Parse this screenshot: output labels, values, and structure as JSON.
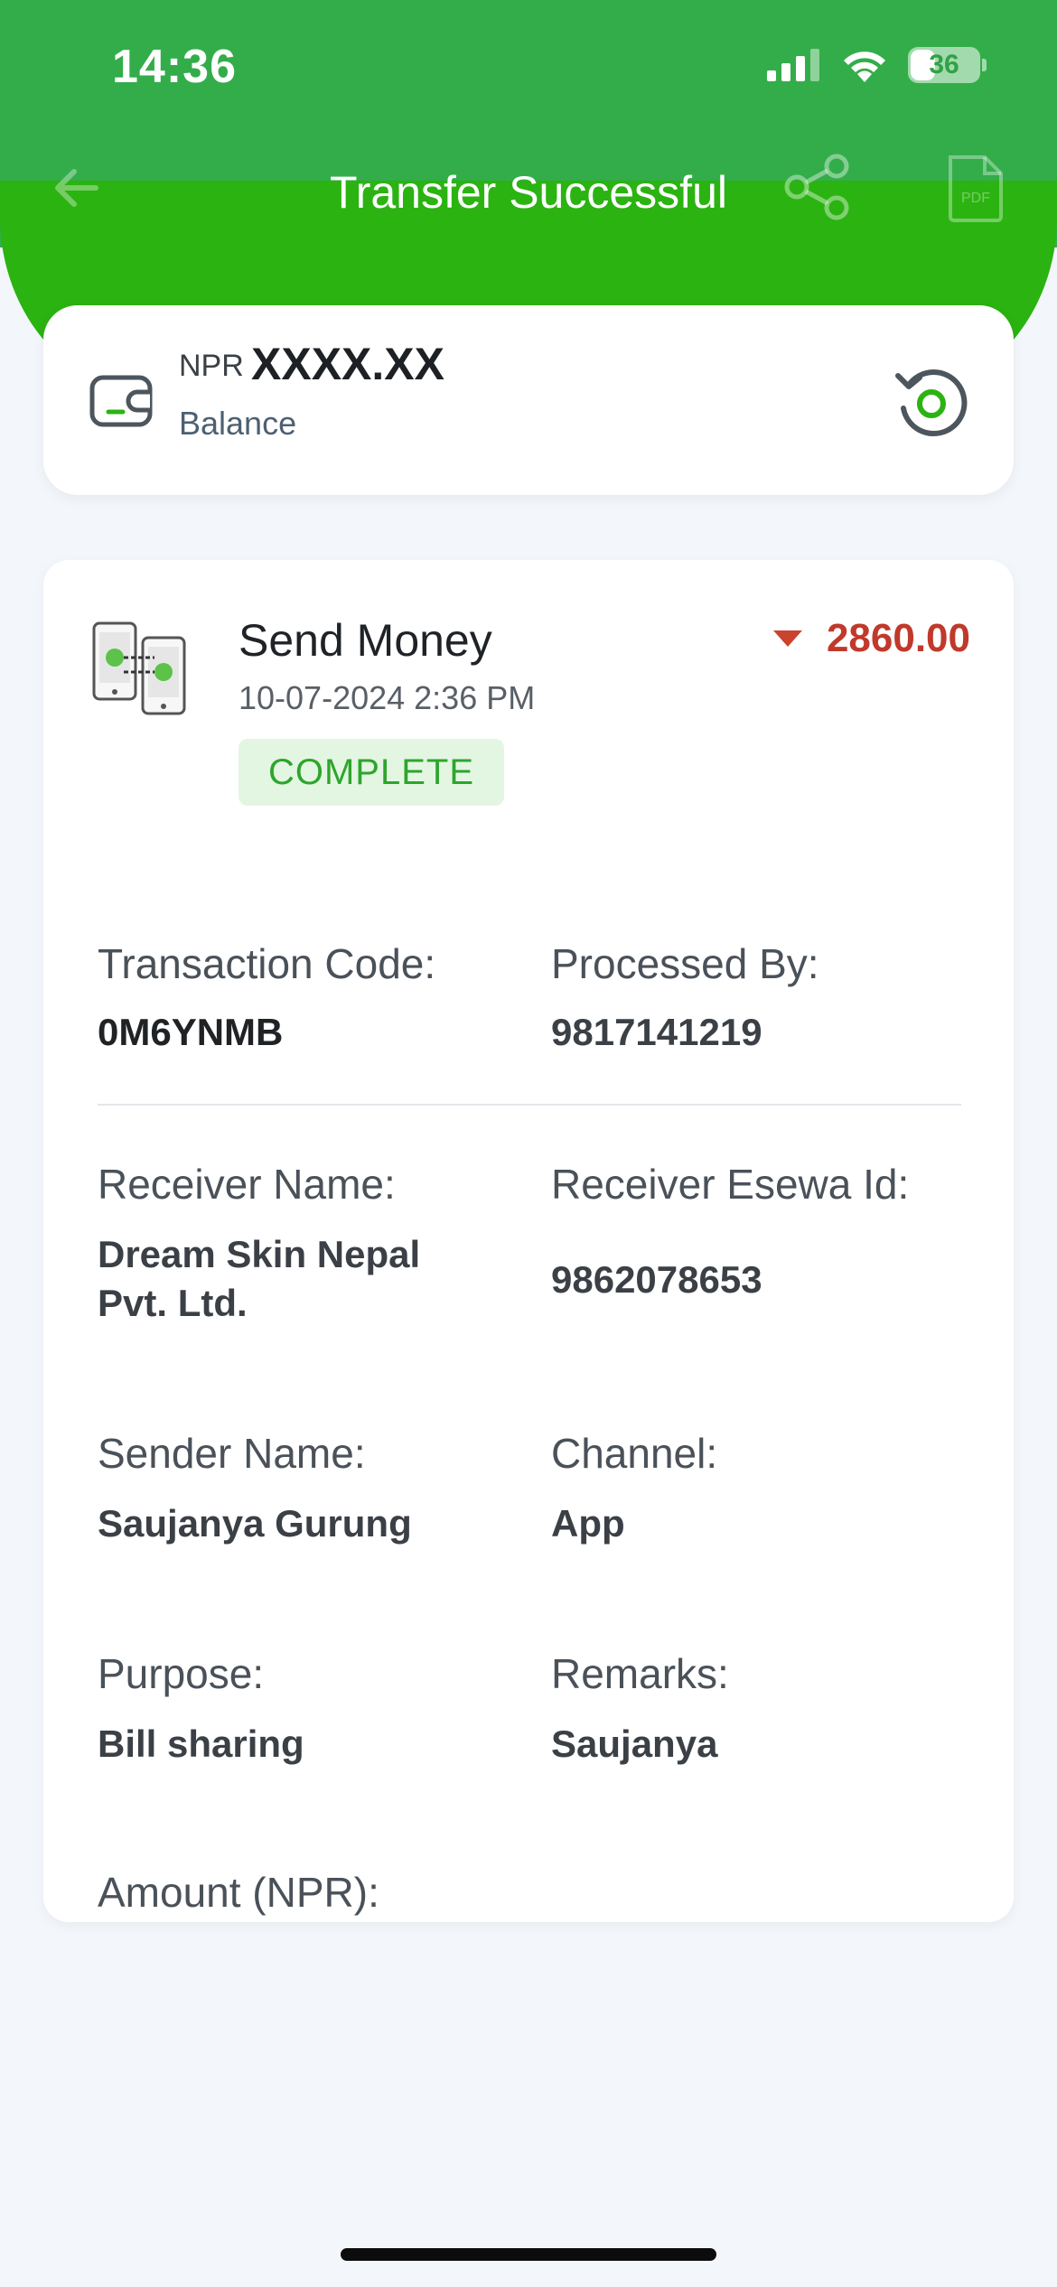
{
  "status_bar": {
    "time": "14:36",
    "battery": "36",
    "battery_level": 0.36,
    "icons": [
      "signal-icon",
      "wifi-icon",
      "battery-icon"
    ]
  },
  "nav": {
    "title": "Transfer Successful",
    "icons": [
      "back-arrow-icon",
      "share-icon",
      "pdf-icon"
    ]
  },
  "balance": {
    "currency": "NPR",
    "amount": "XXXX.XX",
    "label": "Balance"
  },
  "transaction": {
    "type": "Send Money",
    "date": "10-07-2024 2:36 PM",
    "status": "COMPLETE",
    "amount": "2860.00",
    "fields": {
      "transaction_code": {
        "label": "Transaction Code:",
        "value": "0M6YNMB"
      },
      "processed_by": {
        "label": "Processed By:",
        "value": "9817141219"
      },
      "receiver_name": {
        "label": "Receiver Name:",
        "value": "Dream Skin Nepal Pvt. Ltd."
      },
      "receiver_esewa_id": {
        "label": "Receiver Esewa Id:",
        "value": "9862078653"
      },
      "sender_name": {
        "label": "Sender Name:",
        "value": "Saujanya Gurung"
      },
      "channel": {
        "label": "Channel:",
        "value": "App"
      },
      "purpose": {
        "label": "Purpose:",
        "value": "Bill sharing"
      },
      "remarks": {
        "label": "Remarks:",
        "value": "Saujanya"
      },
      "amount_npr": {
        "label": "Amount (NPR):"
      }
    }
  },
  "colors": {
    "header_green": "#33ad4a",
    "accent_green": "#2bb312",
    "debit_red": "#c0392b",
    "status_green": "#2ea52c"
  }
}
